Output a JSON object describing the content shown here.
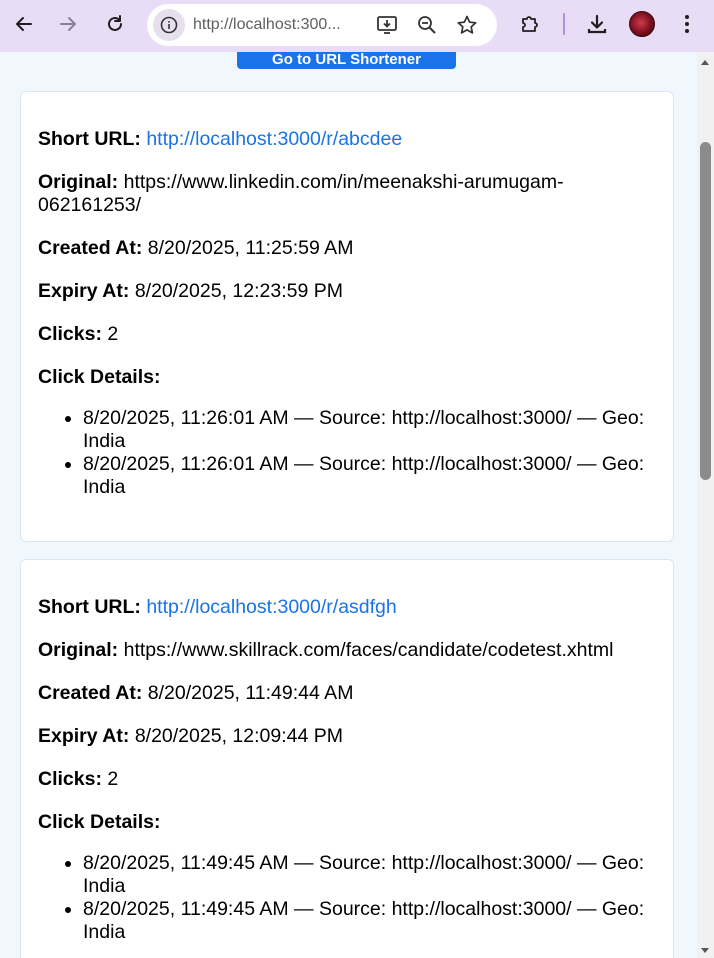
{
  "browser": {
    "url": "http://localhost:3000",
    "url_display": "http://localhost:300..."
  },
  "page": {
    "top_button_label": "Go to URL Shortener",
    "cards": [
      {
        "short_url_label": "Short URL:",
        "short_url": "http://localhost:3000/r/abcdee",
        "original_label": "Original:",
        "original": "https://www.linkedin.com/in/meenakshi-arumugam-062161253/",
        "created_label": "Created At:",
        "created": "8/20/2025, 11:25:59 AM",
        "expiry_label": "Expiry At:",
        "expiry": "8/20/2025, 12:23:59 PM",
        "clicks_label": "Clicks:",
        "clicks": "2",
        "details_label": "Click Details:",
        "details": [
          "8/20/2025, 11:26:01 AM — Source: http://localhost:3000/ — Geo: India",
          "8/20/2025, 11:26:01 AM — Source: http://localhost:3000/ — Geo: India"
        ]
      },
      {
        "short_url_label": "Short URL:",
        "short_url": "http://localhost:3000/r/asdfgh",
        "original_label": "Original:",
        "original": "https://www.skillrack.com/faces/candidate/codetest.xhtml",
        "created_label": "Created At:",
        "created": "8/20/2025, 11:49:44 AM",
        "expiry_label": "Expiry At:",
        "expiry": "8/20/2025, 12:09:44 PM",
        "clicks_label": "Clicks:",
        "clicks": "2",
        "details_label": "Click Details:",
        "details": [
          "8/20/2025, 11:49:45 AM — Source: http://localhost:3000/ — Geo: India",
          "8/20/2025, 11:49:45 AM — Source: http://localhost:3000/ — Geo: India"
        ]
      }
    ]
  },
  "icons": {
    "back": "arrow-left-icon",
    "forward": "arrow-right-icon",
    "reload": "reload-icon",
    "site_info": "info-icon",
    "install": "install-app-icon",
    "zoom": "zoom-icon",
    "bookmark": "star-icon",
    "extensions": "puzzle-icon",
    "downloads": "download-icon",
    "menu": "kebab-menu-icon"
  },
  "colors": {
    "toolbar_bg": "#e9dcf6",
    "page_bg": "#f0f7fd",
    "link": "#1a73e8",
    "button": "#1a73e8"
  }
}
